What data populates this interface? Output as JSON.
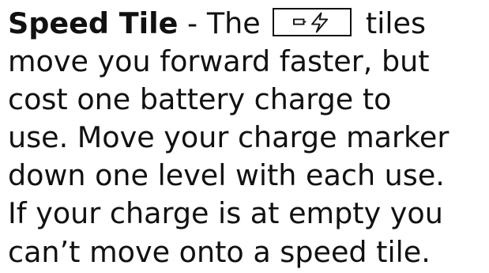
{
  "rule": {
    "term": "Speed Tile",
    "separator": " - The ",
    "tile_icon": "battery-lightning-icon",
    "line1_after": " tiles",
    "line2": "move you forward faster, but",
    "line3": "cost one battery charge to",
    "line4": "use. Move your charge marker",
    "line5": "down one level with each use.",
    "line6": "If your charge is at empty you",
    "line7": "can’t move onto a speed tile."
  },
  "colors": {
    "text": "#111111",
    "background": "#ffffff"
  }
}
